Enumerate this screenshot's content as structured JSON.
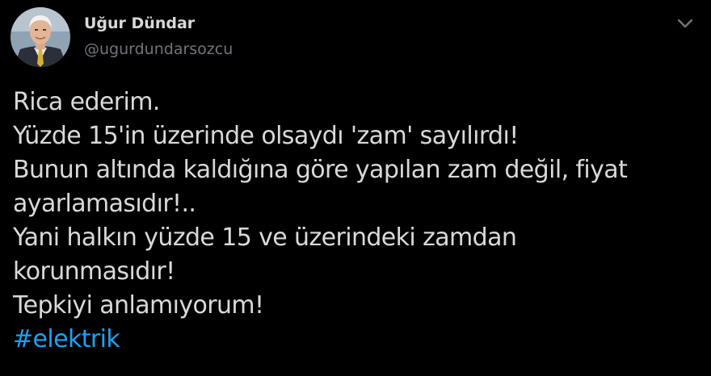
{
  "author": {
    "display_name": "Uğur Dündar",
    "handle": "@ugurdundarsozcu"
  },
  "tweet": {
    "lines": [
      "Rica ederim.",
      "Yüzde 15'in üzerinde olsaydı 'zam' sayılırdı!",
      "Bunun altında kaldığına göre yapılan zam değil, fiyat",
      "ayarlamasıdır!..",
      "Yani halkın yüzde 15 ve üzerindeki zamdan",
      "korunmasıdır!",
      "Tepkiyi anlamıyorum!"
    ],
    "hashtag": "#elektrik"
  },
  "icons": {
    "menu": "chevron-down-icon",
    "avatar": "profile-photo"
  },
  "colors": {
    "background": "#000000",
    "text": "#d9d9d9",
    "secondary": "#6e767d",
    "link": "#1da1f2"
  }
}
